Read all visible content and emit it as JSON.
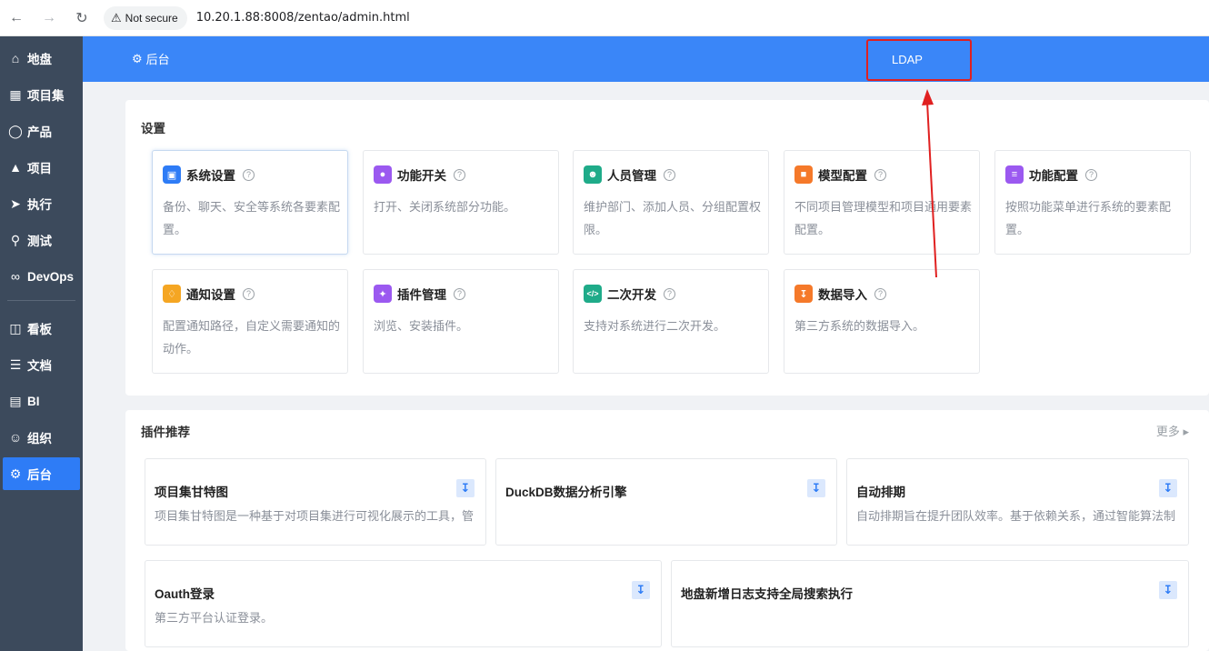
{
  "browser": {
    "secure_label": "Not secure",
    "url": "10.20.1.88:8008/zentao/admin.html"
  },
  "sidebar": {
    "items": [
      {
        "label": "地盘",
        "icon": "home-icon"
      },
      {
        "label": "项目集",
        "icon": "grid-icon"
      },
      {
        "label": "产品",
        "icon": "lightbulb-icon"
      },
      {
        "label": "项目",
        "icon": "rocket-icon"
      },
      {
        "label": "执行",
        "icon": "runner-icon"
      },
      {
        "label": "测试",
        "icon": "search-icon"
      },
      {
        "label": "DevOps",
        "icon": "infinity-icon"
      },
      {
        "label": "看板",
        "icon": "kanban-icon"
      },
      {
        "label": "文档",
        "icon": "document-icon"
      },
      {
        "label": "BI",
        "icon": "chart-icon"
      },
      {
        "label": "组织",
        "icon": "user-icon"
      },
      {
        "label": "后台",
        "icon": "gear-icon"
      }
    ]
  },
  "header": {
    "home_label": "后台",
    "ldap_label": "LDAP"
  },
  "settings": {
    "title": "设置",
    "cards": [
      {
        "title": "系统设置",
        "desc": "备份、聊天、安全等系统各要素配置。",
        "icon": "monitor-icon",
        "color": "#2e7cf6"
      },
      {
        "title": "功能开关",
        "desc": "打开、关闭系统部分功能。",
        "icon": "toggle-icon",
        "color": "#9b59f0"
      },
      {
        "title": "人员管理",
        "desc": "维护部门、添加人员、分组配置权限。",
        "icon": "people-icon",
        "color": "#1fab89"
      },
      {
        "title": "模型配置",
        "desc": "不同项目管理模型和项目通用要素配置。",
        "icon": "cube-icon",
        "color": "#f5792a"
      },
      {
        "title": "功能配置",
        "desc": "按照功能菜单进行系统的要素配置。",
        "icon": "sliders-icon",
        "color": "#9b59f0"
      },
      {
        "title": "通知设置",
        "desc": "配置通知路径，自定义需要通知的动作。",
        "icon": "bell-icon",
        "color": "#f5a623"
      },
      {
        "title": "插件管理",
        "desc": "浏览、安装插件。",
        "icon": "puzzle-icon",
        "color": "#9b59f0"
      },
      {
        "title": "二次开发",
        "desc": "支持对系统进行二次开发。",
        "icon": "code-icon",
        "color": "#1fab89"
      },
      {
        "title": "数据导入",
        "desc": "第三方系统的数据导入。",
        "icon": "import-icon",
        "color": "#f5792a"
      }
    ]
  },
  "plugins": {
    "title": "插件推荐",
    "more_label": "更多",
    "cards": [
      {
        "title": "项目集甘特图",
        "desc": "项目集甘特图是一种基于对项目集进行可视化展示的工具，管"
      },
      {
        "title": "DuckDB数据分析引擎",
        "desc": ""
      },
      {
        "title": "自动排期",
        "desc": "自动排期旨在提升团队效率。基于依赖关系，通过智能算法制"
      },
      {
        "title": "Oauth登录",
        "desc": "第三方平台认证登录。"
      },
      {
        "title": "地盘新增日志支持全局搜索执行",
        "desc": ""
      }
    ]
  },
  "colors": {
    "accent": "#3a86f8",
    "highlight_box": "#e02020"
  }
}
